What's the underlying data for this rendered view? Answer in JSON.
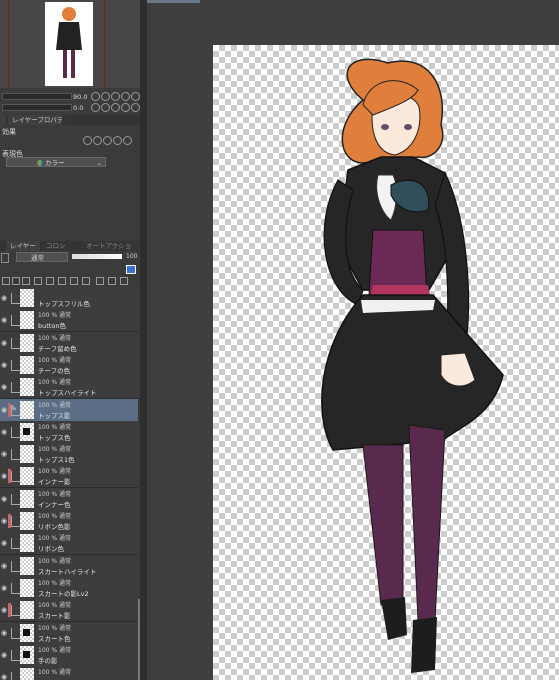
{
  "navigator": {
    "zoom_value": "90.0",
    "rotate_value": "0.0"
  },
  "tabs": {
    "layer_property": "レイヤープロパティ"
  },
  "property": {
    "effect_label": "効果",
    "color_label": "表現色",
    "color_mode": "カラー"
  },
  "layer_panel": {
    "tabs": [
      {
        "label": "レイヤー"
      },
      {
        "label": "コロシ"
      },
      {
        "label": "オートアクション"
      }
    ],
    "blend_mode": "通常",
    "opacity": "100"
  },
  "layers": [
    {
      "mode": "",
      "name": "トップスフリル色",
      "marker": false,
      "thumb": "none"
    },
    {
      "mode": "100 % 通常",
      "name": "button色",
      "marker": false,
      "thumb": "none"
    },
    {
      "mode": "100 % 通常",
      "name": "チーフ留め色",
      "marker": false,
      "thumb": "none"
    },
    {
      "mode": "100 % 通常",
      "name": "チーフの色",
      "marker": false,
      "thumb": "none"
    },
    {
      "mode": "100 % 通常",
      "name": "トップスハイライト",
      "marker": false,
      "thumb": "none"
    },
    {
      "mode": "100 % 通常",
      "name": "トップス影",
      "marker": true,
      "thumb": "none",
      "selected": true
    },
    {
      "mode": "100 % 通常",
      "name": "トップス色",
      "marker": false,
      "thumb": "figure"
    },
    {
      "mode": "100 % 通常",
      "name": "トップス1色",
      "marker": false,
      "thumb": "none"
    },
    {
      "mode": "100 % 通常",
      "name": "インナー影",
      "marker": true,
      "thumb": "none"
    },
    {
      "mode": "100 % 通常",
      "name": "インナー色",
      "marker": false,
      "thumb": "none"
    },
    {
      "mode": "100 % 通常",
      "name": "リボン色影",
      "marker": true,
      "thumb": "none"
    },
    {
      "mode": "100 % 通常",
      "name": "リボン色",
      "marker": false,
      "thumb": "none"
    },
    {
      "mode": "100 % 通常",
      "name": "スカートハイライト",
      "marker": false,
      "thumb": "none"
    },
    {
      "mode": "100 % 通常",
      "name": "スカートの影Lv2",
      "marker": false,
      "thumb": "none"
    },
    {
      "mode": "100 % 通常",
      "name": "スカート影",
      "marker": true,
      "thumb": "none"
    },
    {
      "mode": "100 % 通常",
      "name": "スカート色",
      "marker": false,
      "thumb": "dark"
    },
    {
      "mode": "100 % 通常",
      "name": "手の影",
      "marker": false,
      "thumb": "dark"
    },
    {
      "mode": "100 % 通常",
      "name": "",
      "marker": false,
      "thumb": "none"
    }
  ],
  "colors": {
    "selected_layer": "#5a6d84",
    "marker": "#c86464",
    "hair": "#e07f3c",
    "dress": "#222222",
    "tights": "#5a2a4e",
    "ribbon": "#b2355f"
  }
}
